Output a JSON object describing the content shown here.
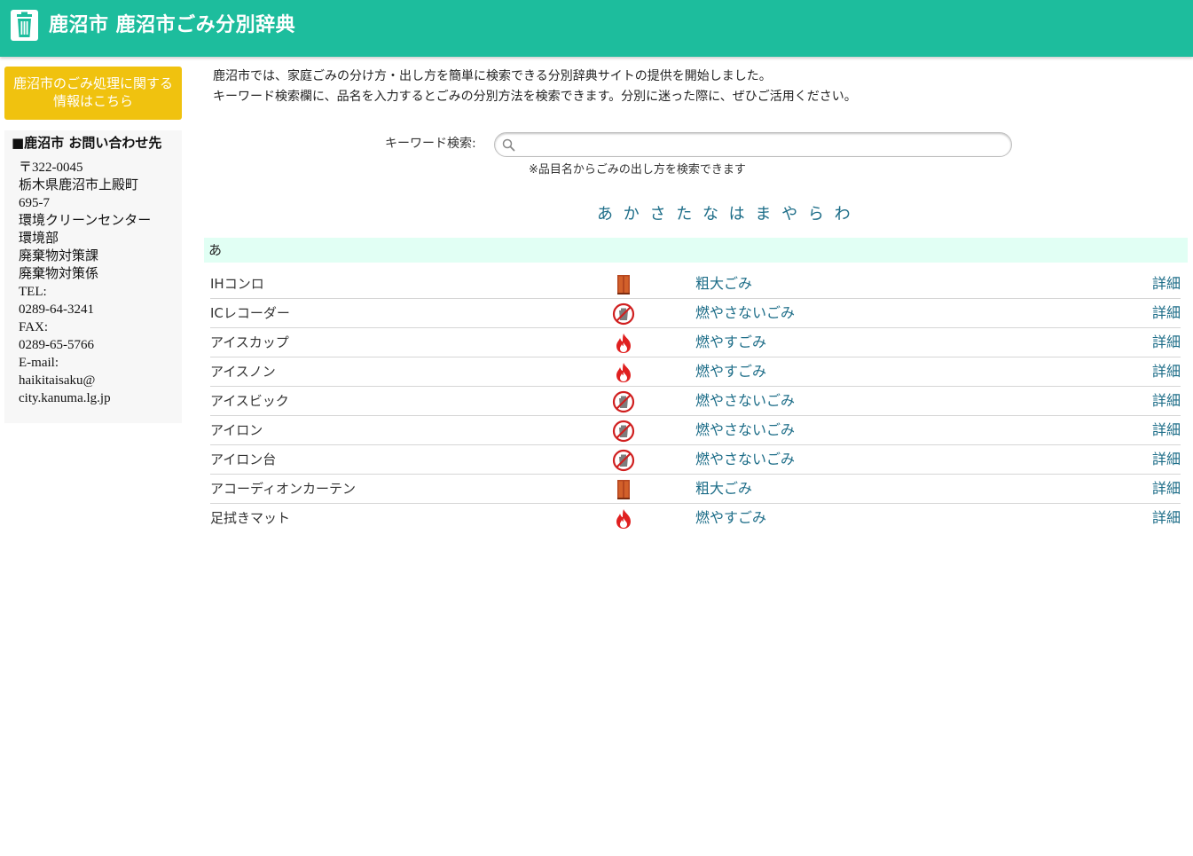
{
  "colors": {
    "brand": "#1dbd9d",
    "info_button": "#f0c20f",
    "link": "#1d6d88",
    "section_bg": "#e1fff4"
  },
  "header": {
    "title": "鹿沼市 鹿沼市ごみ分別辞典",
    "icon": "trash-can-icon"
  },
  "sidebar": {
    "info_button_label": "鹿沼市のごみ処理に関する情報はこちら",
    "contact_title": "■鹿沼市 お問い合わせ先",
    "contact_lines": [
      "〒322-0045",
      "栃木県鹿沼市上殿町",
      "695-7",
      "環境クリーンセンター",
      "環境部",
      "廃棄物対策課",
      "廃棄物対策係",
      "TEL:",
      "0289-64-3241",
      "FAX:",
      "0289-65-5766",
      "E-mail:",
      "haikitaisaku@",
      "city.kanuma.lg.jp"
    ]
  },
  "intro": {
    "line1": "鹿沼市では、家庭ごみの分け方・出し方を簡単に検索できる分別辞典サイトの提供を開始しました。",
    "line2": "キーワード検索欄に、品名を入力するとごみの分別方法を検索できます。分別に迷った際に、ぜひご活用ください。"
  },
  "search": {
    "label": "キーワード検索:",
    "value": "",
    "placeholder": "",
    "note": "※品目名からごみの出し方を検索できます"
  },
  "kana_nav": [
    "あ",
    "か",
    "さ",
    "た",
    "な",
    "は",
    "ま",
    "や",
    "ら",
    "わ"
  ],
  "section": {
    "heading": "あ"
  },
  "items": [
    {
      "name": "IHコンロ",
      "icon": "bulky-waste-icon",
      "category": "粗大ごみ",
      "detail": "詳細"
    },
    {
      "name": "ICレコーダー",
      "icon": "non-burnable-icon",
      "category": "燃やさないごみ",
      "detail": "詳細"
    },
    {
      "name": "アイスカップ",
      "icon": "burnable-icon",
      "category": "燃やすごみ",
      "detail": "詳細"
    },
    {
      "name": "アイスノン",
      "icon": "burnable-icon",
      "category": "燃やすごみ",
      "detail": "詳細"
    },
    {
      "name": "アイスビック",
      "icon": "non-burnable-icon",
      "category": "燃やさないごみ",
      "detail": "詳細"
    },
    {
      "name": "アイロン",
      "icon": "non-burnable-icon",
      "category": "燃やさないごみ",
      "detail": "詳細"
    },
    {
      "name": "アイロン台",
      "icon": "non-burnable-icon",
      "category": "燃やさないごみ",
      "detail": "詳細"
    },
    {
      "name": "アコーディオンカーテン",
      "icon": "bulky-waste-icon",
      "category": "粗大ごみ",
      "detail": "詳細"
    },
    {
      "name": "足拭きマット",
      "icon": "burnable-icon",
      "category": "燃やすごみ",
      "detail": "詳細"
    }
  ]
}
